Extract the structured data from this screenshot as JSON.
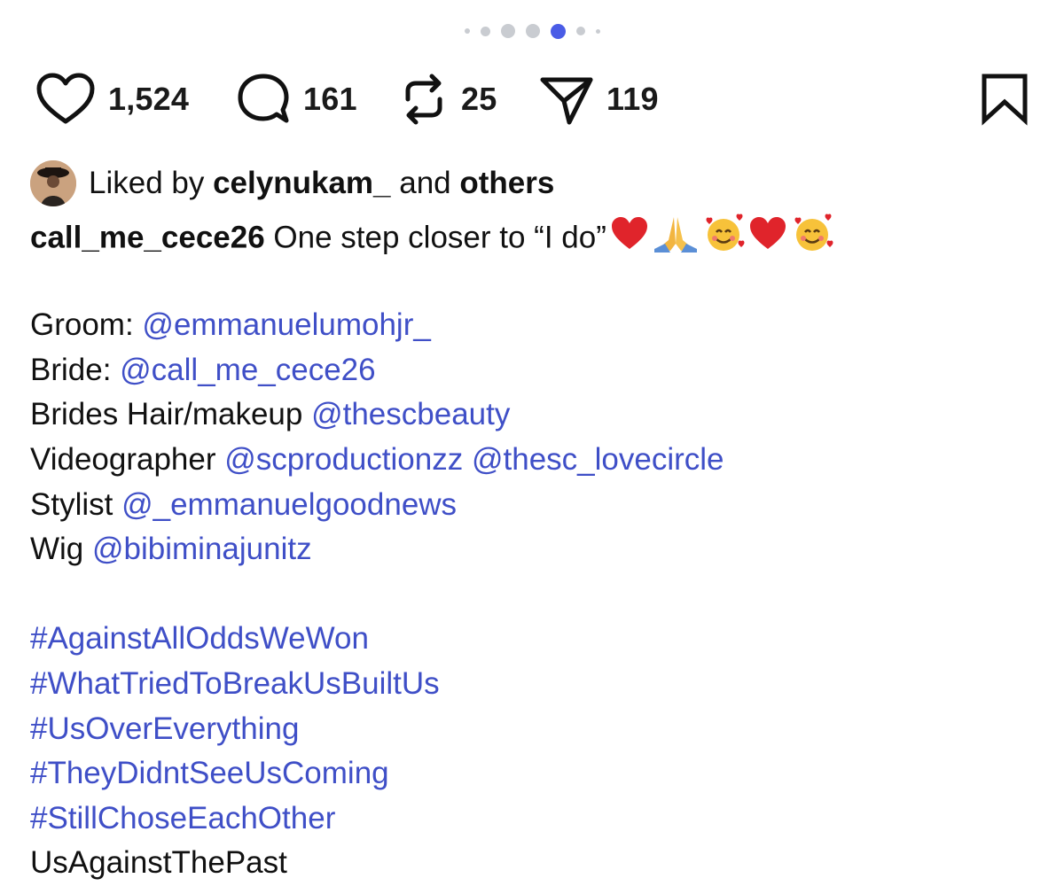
{
  "carousel": {
    "count": 7,
    "active_index": 4
  },
  "actions": {
    "likes": "1,524",
    "comments": "161",
    "reposts": "25",
    "shares": "119"
  },
  "liked_by": {
    "prefix": "Liked by ",
    "user": "celynukam_",
    "middle": " and ",
    "others": "others"
  },
  "post": {
    "username": "call_me_cece26",
    "text": " One step closer to “I do”",
    "emojis": [
      "red-heart",
      "folded-hands",
      "smiling-face-with-hearts",
      "red-heart",
      "smiling-face-with-hearts"
    ],
    "credits": [
      {
        "label": "Groom: ",
        "handles": [
          "@emmanuelumohjr_"
        ]
      },
      {
        "label": "Bride: ",
        "handles": [
          "@call_me_cece26"
        ]
      },
      {
        "label": "Brides Hair/makeup ",
        "handles": [
          "@thescbeauty"
        ]
      },
      {
        "label": "Videographer ",
        "handles": [
          "@scproductionzz",
          "@thesc_lovecircle"
        ]
      },
      {
        "label": "Stylist ",
        "handles": [
          "@_emmanuelgoodnews"
        ]
      },
      {
        "label": "Wig ",
        "handles": [
          "@bibiminajunitz"
        ]
      }
    ],
    "hashtags": [
      "#AgainstAllOddsWeWon",
      "#WhatTriedToBreakUsBuiltUs",
      "#UsOverEverything",
      "#TheyDidntSeeUsComing",
      "#StillChoseEachOther"
    ],
    "last_line": "UsAgainstThePast"
  },
  "colors": {
    "link": "#3f4fc7",
    "active_dot": "#4a5ce6",
    "inactive_dot": "#c9ccd1"
  }
}
